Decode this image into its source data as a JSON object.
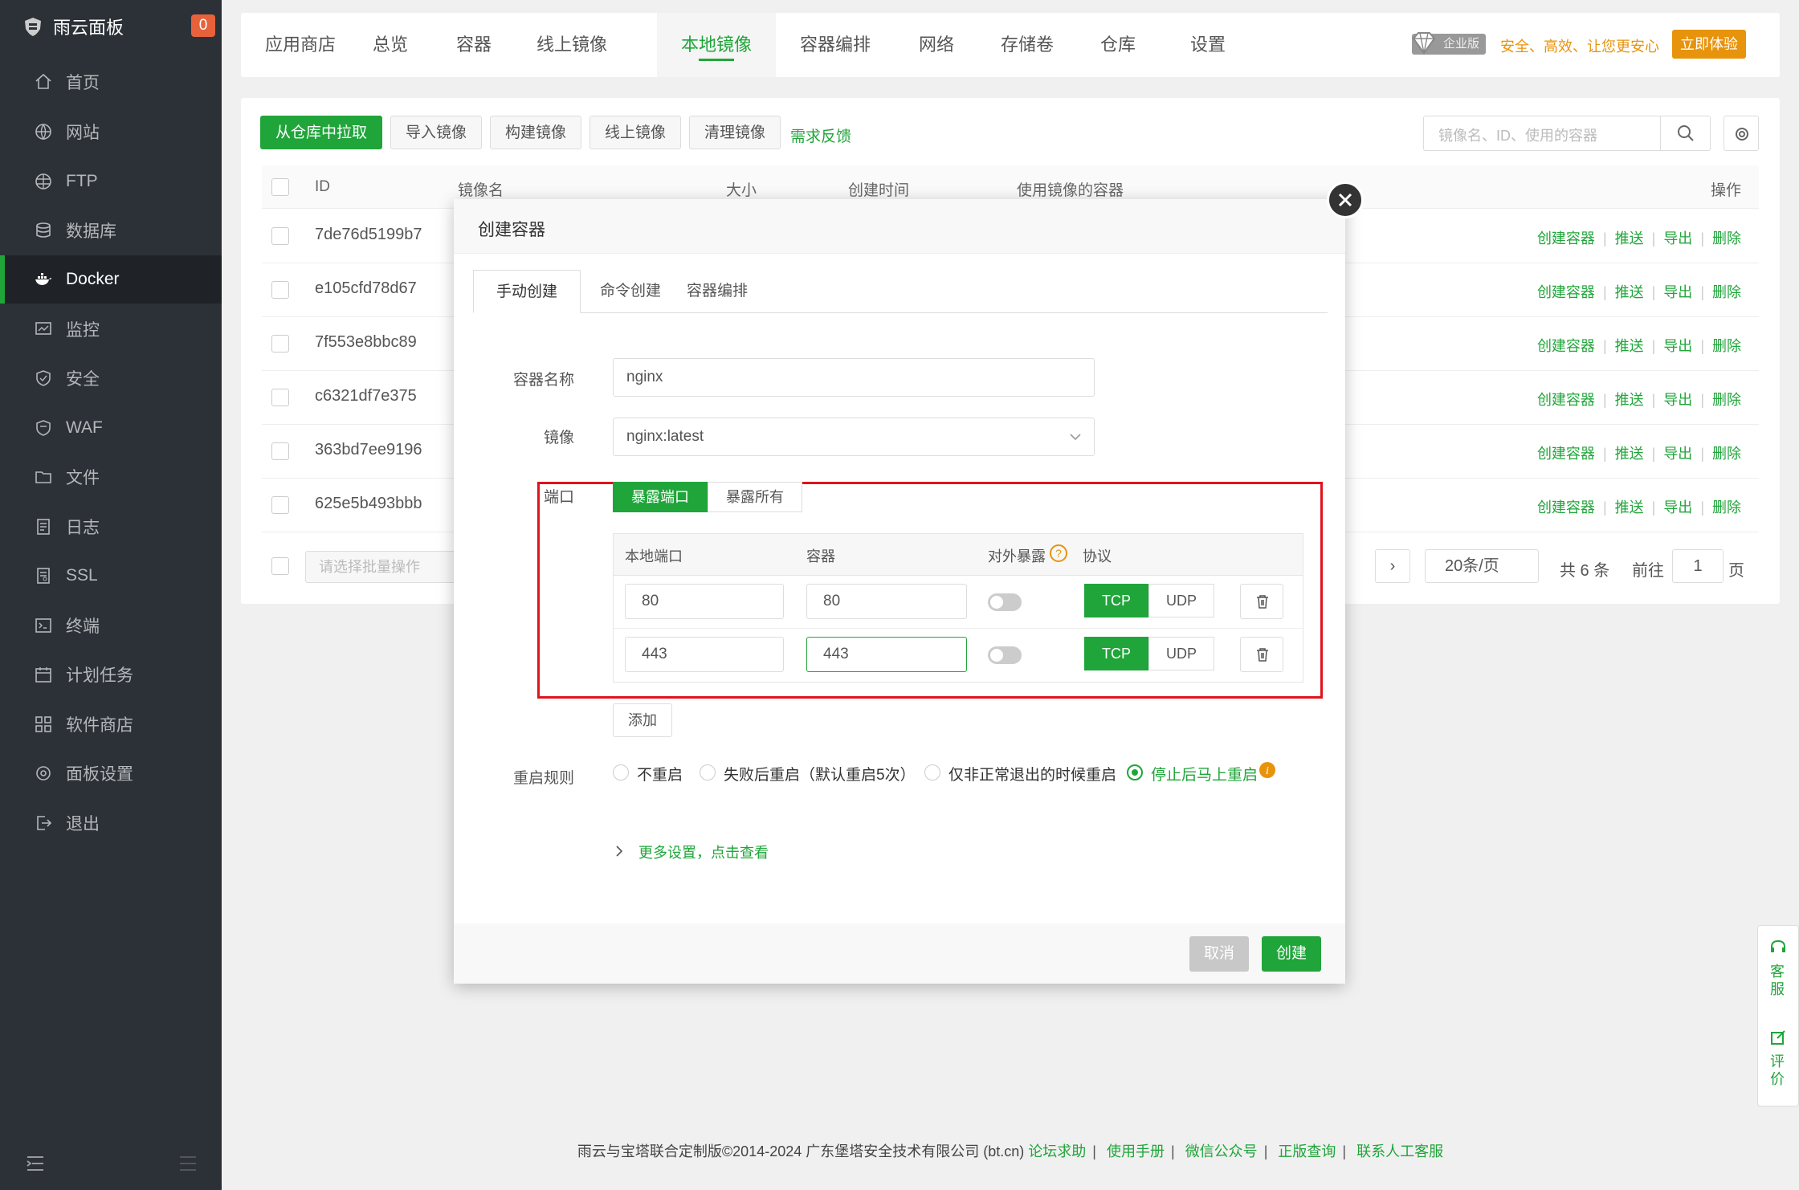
{
  "app": {
    "title": "雨云面板",
    "message_count": "0"
  },
  "sidebar": {
    "items": [
      {
        "label": "首页",
        "icon": "home-icon"
      },
      {
        "label": "网站",
        "icon": "globe-icon"
      },
      {
        "label": "FTP",
        "icon": "ftp-icon"
      },
      {
        "label": "数据库",
        "icon": "database-icon"
      },
      {
        "label": "Docker",
        "icon": "docker-icon",
        "active": true
      },
      {
        "label": "监控",
        "icon": "monitor-icon"
      },
      {
        "label": "安全",
        "icon": "shield-icon"
      },
      {
        "label": "WAF",
        "icon": "waf-shield-icon"
      },
      {
        "label": "文件",
        "icon": "folder-icon"
      },
      {
        "label": "日志",
        "icon": "log-icon"
      },
      {
        "label": "SSL",
        "icon": "ssl-icon"
      },
      {
        "label": "终端",
        "icon": "terminal-icon"
      },
      {
        "label": "计划任务",
        "icon": "calendar-icon"
      },
      {
        "label": "软件商店",
        "icon": "apps-icon"
      },
      {
        "label": "面板设置",
        "icon": "settings-icon"
      },
      {
        "label": "退出",
        "icon": "logout-icon"
      }
    ]
  },
  "topnav": {
    "items": [
      "应用商店",
      "总览",
      "容器",
      "线上镜像",
      "本地镜像",
      "容器编排",
      "网络",
      "存储卷",
      "仓库",
      "设置"
    ],
    "active": "本地镜像",
    "enterprise_badge": "企业版",
    "slogan": "安全、高效、让您更安心",
    "trial_button": "立即体验"
  },
  "toolbar": {
    "pull_button": "从仓库中拉取",
    "import_button": "导入镜像",
    "build_button": "构建镜像",
    "online_button": "线上镜像",
    "clean_button": "清理镜像",
    "feedback_link": "需求反馈",
    "search_placeholder": "镜像名、ID、使用的容器"
  },
  "table": {
    "headers": {
      "id": "ID",
      "name": "镜像名",
      "size": "大小",
      "created": "创建时间",
      "containers": "使用镜像的容器",
      "ops": "操作"
    },
    "rows": [
      {
        "id": "7de76d5199b7"
      },
      {
        "id": "e105cfd78d67"
      },
      {
        "id": "7f553e8bbc89"
      },
      {
        "id": "c6321df7e375"
      },
      {
        "id": "363bd7ee9196"
      },
      {
        "id": "625e5b493bbb"
      }
    ],
    "ops": {
      "create": "创建容器",
      "push": "推送",
      "export": "导出",
      "delete": "删除"
    },
    "batch_placeholder": "请选择批量操作"
  },
  "pagination": {
    "per_page": "20条/页",
    "total": "共 6 条",
    "goto_label": "前往",
    "page": "1",
    "page_suffix": "页"
  },
  "modal": {
    "title": "创建容器",
    "tabs": [
      "手动创建",
      "命令创建",
      "容器编排"
    ],
    "name_label": "容器名称",
    "name_value": "nginx",
    "image_label": "镜像",
    "image_value": "nginx:latest",
    "port_label": "端口",
    "expose_port": "暴露端口",
    "expose_all": "暴露所有",
    "port_headers": {
      "local": "本地端口",
      "container": "容器",
      "external": "对外暴露",
      "protocol": "协议"
    },
    "ports": [
      {
        "local": "80",
        "container": "80"
      },
      {
        "local": "443",
        "container": "443"
      }
    ],
    "tcp": "TCP",
    "udp": "UDP",
    "add_button": "添加",
    "restart_label": "重启规则",
    "restart_options": [
      "不重启",
      "失败后重启（默认重启5次）",
      "仅非正常退出的时候重启",
      "停止后马上重启"
    ],
    "more_settings": "更多设置，点击查看",
    "cancel_button": "取消",
    "create_button": "创建"
  },
  "float_tools": {
    "service": "客服",
    "review": "评价"
  },
  "footer": {
    "copyright": "雨云与宝塔联合定制版©2014-2024 广东堡塔安全技术有限公司 (bt.cn)",
    "links": [
      "论坛求助",
      "使用手册",
      "微信公众号",
      "正版查询",
      "联系人工客服"
    ]
  },
  "colors": {
    "primary": "#20a53a",
    "sidebar": "#2c3137",
    "accent": "#e8930c",
    "highlight": "#e0131c"
  }
}
